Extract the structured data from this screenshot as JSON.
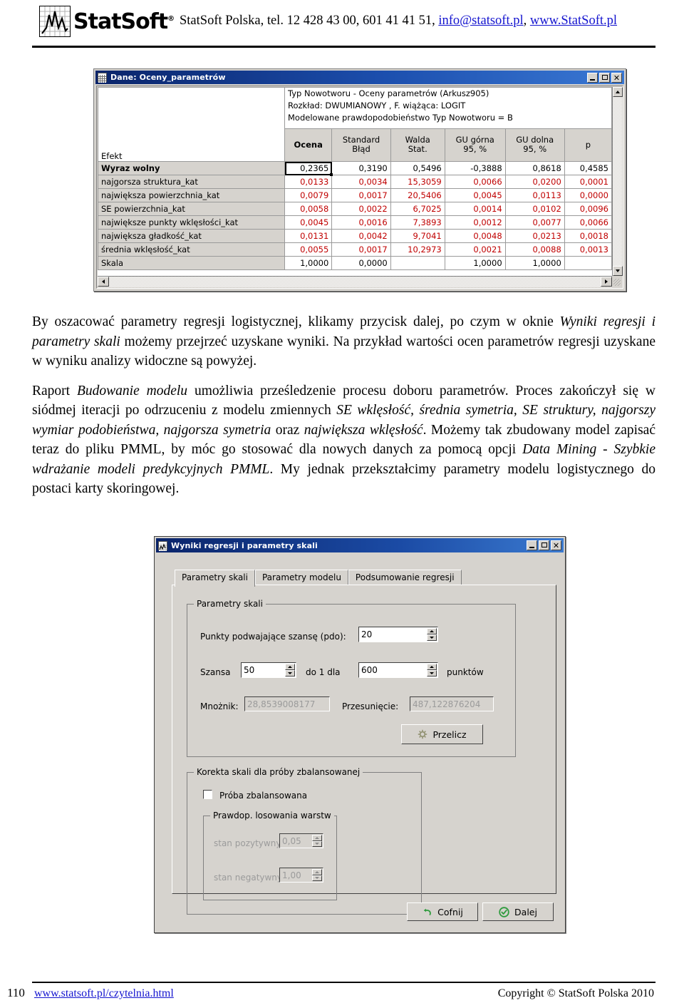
{
  "header": {
    "brand": "StatSoft",
    "brand_reg": "®",
    "contact_prefix": "StatSoft Polska, tel. 12 428 43 00, 601 41 41 51, ",
    "email": "info@statsoft.pl",
    "separator": ", ",
    "website": "www.StatSoft.pl"
  },
  "data_window": {
    "title": "Dane: Oceny_parametrów",
    "icon": "spreadsheet-icon",
    "minimize_label": "_",
    "maximize_label": "□",
    "close_label": "✕",
    "caption_lines": [
      "Typ Nowotworu - Oceny parametrów (Arkusz905)",
      "Rozkład: DWUMIANOWY , F. wiążąca: LOGIT",
      "Modelowane prawdopodobieństwo Typ Nowotworu = B"
    ],
    "corner_label": "Efekt",
    "columns": [
      {
        "line1": "Ocena",
        "line2": "",
        "bold": true
      },
      {
        "line1": "Standard",
        "line2": "Błąd",
        "bold": false
      },
      {
        "line1": "Walda",
        "line2": "Stat.",
        "bold": false
      },
      {
        "line1": "GU górna",
        "line2": "95,  %",
        "bold": false
      },
      {
        "line1": "GU dolna",
        "line2": "95,  %",
        "bold": false
      },
      {
        "line1": "p",
        "line2": "",
        "bold": false
      }
    ],
    "rows": [
      {
        "label": "Wyraz wolny",
        "bold": true,
        "red": false,
        "selected_first": true,
        "values": [
          "0,2365",
          "0,3190",
          "0,5496",
          "-0,3888",
          "0,8618",
          "0,4585"
        ]
      },
      {
        "label": "najgorsza struktura_kat",
        "bold": false,
        "red": true,
        "selected_first": false,
        "values": [
          "0,0133",
          "0,0034",
          "15,3059",
          "0,0066",
          "0,0200",
          "0,0001"
        ]
      },
      {
        "label": "największa powierzchnia_kat",
        "bold": false,
        "red": true,
        "selected_first": false,
        "values": [
          "0,0079",
          "0,0017",
          "20,5406",
          "0,0045",
          "0,0113",
          "0,0000"
        ]
      },
      {
        "label": "SE powierzchnia_kat",
        "bold": false,
        "red": true,
        "selected_first": false,
        "values": [
          "0,0058",
          "0,0022",
          "6,7025",
          "0,0014",
          "0,0102",
          "0,0096"
        ]
      },
      {
        "label": "największe punkty wklęsłości_kat",
        "bold": false,
        "red": true,
        "selected_first": false,
        "values": [
          "0,0045",
          "0,0016",
          "7,3893",
          "0,0012",
          "0,0077",
          "0,0066"
        ]
      },
      {
        "label": "największa gładkość_kat",
        "bold": false,
        "red": true,
        "selected_first": false,
        "values": [
          "0,0131",
          "0,0042",
          "9,7041",
          "0,0048",
          "0,0213",
          "0,0018"
        ]
      },
      {
        "label": "średnia wklęsłość_kat",
        "bold": false,
        "red": true,
        "selected_first": false,
        "values": [
          "0,0055",
          "0,0017",
          "10,2973",
          "0,0021",
          "0,0088",
          "0,0013"
        ]
      },
      {
        "label": "Skala",
        "bold": false,
        "red": false,
        "selected_first": false,
        "values": [
          "1,0000",
          "0,0000",
          "",
          "1,0000",
          "1,0000",
          ""
        ]
      }
    ]
  },
  "paragraphs": {
    "p1_a": "By oszacować parametry regresji logistycznej, klikamy przycisk dalej, po czym w oknie ",
    "p1_i1": "Wyniki regresji i parametry skali",
    "p1_b": " możemy przejrzeć uzyskane wyniki. Na przykład wartości ocen parametrów regresji uzyskane w wyniku analizy widoczne są powyżej.",
    "p2_a": "Raport ",
    "p2_i1": "Budowanie modelu",
    "p2_b": " umożliwia prześledzenie procesu doboru parametrów. Proces zakończył się w siódmej iteracji po odrzuceniu z modelu zmiennych ",
    "p2_i2": "SE wklęsłość, średnia symetria, SE struktury, najgorszy wymiar podobieństwa, najgorsza symetria",
    "p2_c": " oraz ",
    "p2_i3": "największa wklęsłość",
    "p2_d": ". Możemy tak zbudowany model zapisać teraz do pliku PMML, by móc go stosować dla nowych danych za pomocą opcji ",
    "p2_i4": "Data Mining - Szybkie wdrażanie modeli predykcyjnych PMML",
    "p2_e": ". My jednak przekształcimy parametry modelu logistycznego do postaci karty skoringowej."
  },
  "dialog": {
    "title": "Wyniki regresji i parametry skali",
    "icon": "chart-icon",
    "minimize_label": "_",
    "maximize_label": "□",
    "close_label": "✕",
    "tabs": [
      {
        "label": "Parametry skali",
        "active": true
      },
      {
        "label": "Parametry modelu",
        "active": false
      },
      {
        "label": "Podsumowanie regresji",
        "active": false
      }
    ],
    "scale_group": {
      "legend": "Parametry skali",
      "pdo_label": "Punkty podwajające szansę (pdo):",
      "pdo_value": "20",
      "odds_label": "Szansa",
      "odds_value": "50",
      "odds_mid_label": "do 1 dla",
      "points_value": "600",
      "points_label": "punktów",
      "multiplier_label": "Mnożnik:",
      "multiplier_value": "28,8539008177",
      "offset_label": "Przesunięcie:",
      "offset_value": "487,122876204",
      "recalc_button": "Przelicz",
      "recalc_icon": "gear-icon"
    },
    "balance_group": {
      "legend": "Korekta skali dla próby zbalansowanej",
      "checkbox_label": "Próba zbalansowana",
      "checkbox_checked": false,
      "subgroup_legend": "Prawdop. losowania warstw",
      "positive_label": "stan pozytywny:",
      "positive_value": "0,05",
      "negative_label": "stan negatywny:",
      "negative_value": "1,00"
    },
    "buttons": {
      "back_label": "Cofnij",
      "back_icon": "undo-arrow-icon",
      "next_label": "Dalej",
      "next_icon": "green-check-circle-icon"
    }
  },
  "footer": {
    "page_number": "110",
    "link": "www.statsoft.pl/czytelnia.html",
    "copyright": "Copyright © StatSoft Polska 2010"
  }
}
